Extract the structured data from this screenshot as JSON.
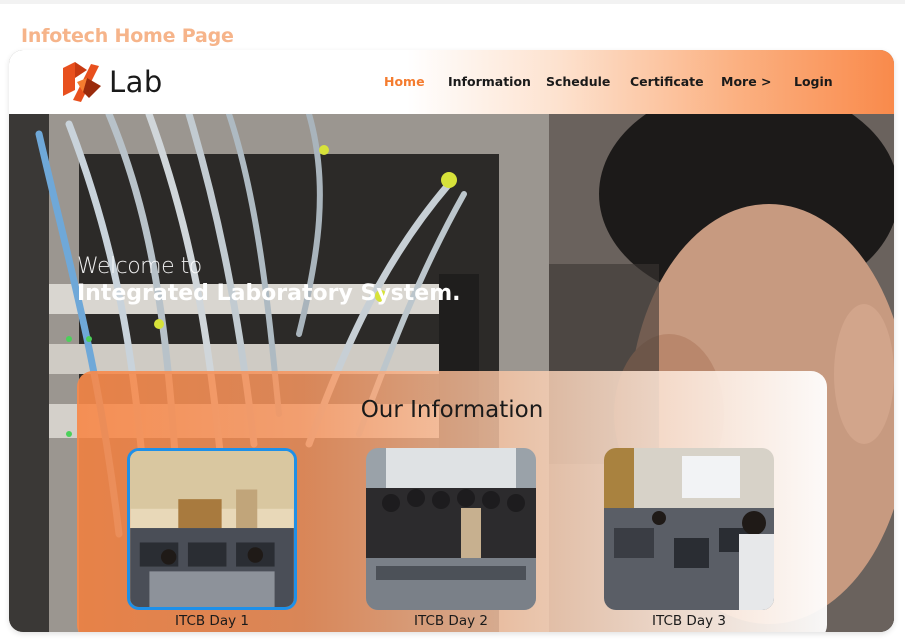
{
  "page": {
    "label": "Infotech Home Page"
  },
  "logo": {
    "text": "Lab",
    "icon": "lab-logo-icon"
  },
  "nav": {
    "items": [
      {
        "label": "Home",
        "active": true
      },
      {
        "label": "Information",
        "active": false
      },
      {
        "label": "Schedule",
        "active": false
      },
      {
        "label": "Certificate",
        "active": false
      },
      {
        "label": "More >",
        "active": false
      },
      {
        "label": "Login",
        "active": false
      }
    ]
  },
  "hero": {
    "line1": "Welcome to",
    "line2": "Integrated Laboratory System."
  },
  "info": {
    "title": "Our Information",
    "cards": [
      {
        "label": "ITCB Day 1"
      },
      {
        "label": "ITCB Day 2"
      },
      {
        "label": "ITCB Day 3"
      }
    ]
  },
  "colors": {
    "accent": "#f47c2f",
    "label": "#f6b48a",
    "selected_border": "#1e90e8"
  }
}
